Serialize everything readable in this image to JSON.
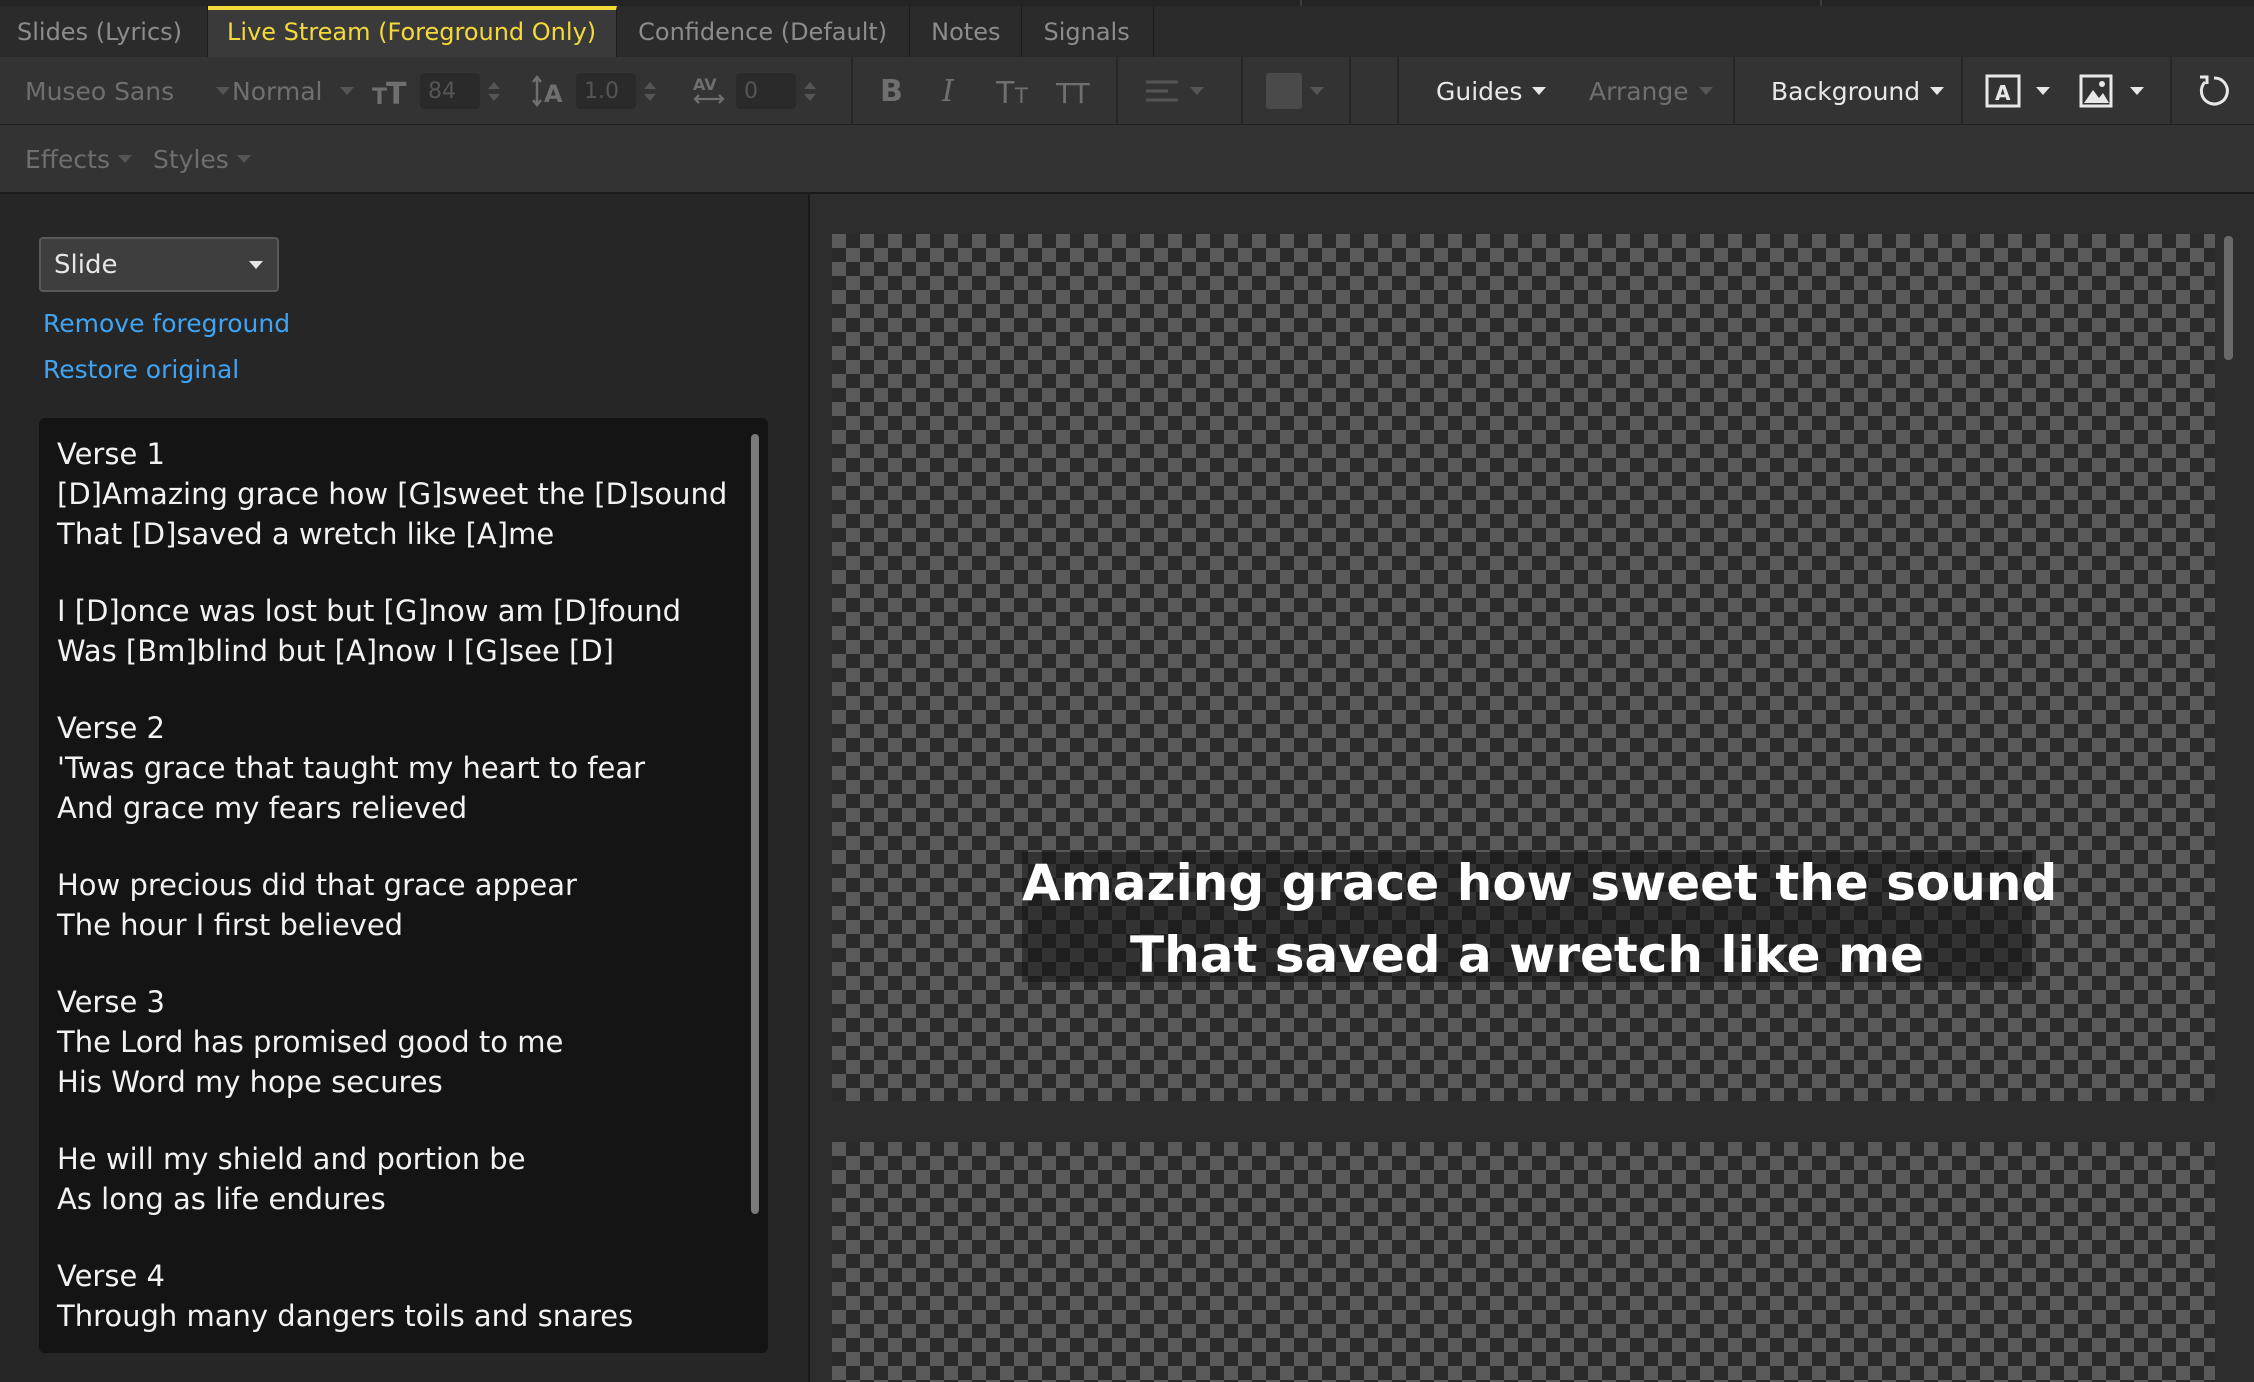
{
  "tabs": [
    {
      "label": "Slides (Lyrics)",
      "active": false
    },
    {
      "label": "Live Stream (Foreground Only)",
      "active": true
    },
    {
      "label": "Confidence (Default)",
      "active": false
    },
    {
      "label": "Notes",
      "active": false
    },
    {
      "label": "Signals",
      "active": false
    }
  ],
  "toolbar": {
    "font_family": "Museo Sans",
    "font_style": "Normal",
    "font_size": "84",
    "line_spacing": "1.0",
    "char_spacing": "0",
    "bold_icon_label": "B",
    "italic_icon_label": "I",
    "guides_label": "Guides",
    "arrange_label": "Arrange",
    "background_label": "Background",
    "effects_label": "Effects",
    "styles_label": "Styles"
  },
  "left_panel": {
    "mode_select_value": "Slide",
    "remove_foreground_link": "Remove foreground",
    "restore_original_link": "Restore original",
    "lyrics_blocks": [
      [
        "Verse 1",
        "[D]Amazing grace how [G]sweet the [D]sound",
        "That [D]saved a wretch like [A]me"
      ],
      [
        "I [D]once was lost but [G]now am [D]found",
        "Was [Bm]blind but [A]now I [G]see [D]"
      ],
      [
        "Verse 2",
        "'Twas grace that taught my heart to fear",
        "And grace my fears relieved"
      ],
      [
        "How precious did that grace appear",
        "The hour I first believed"
      ],
      [
        "Verse 3",
        "The Lord has promised good to me",
        "His Word my hope secures"
      ],
      [
        "He will my shield and portion be",
        "As long as life endures"
      ],
      [
        "Verse 4",
        "Through many dangers toils and snares"
      ]
    ]
  },
  "preview": {
    "slide_line_1": "Amazing grace how sweet the sound",
    "slide_line_2": "That saved a wretch like me"
  },
  "colors": {
    "active_tab_accent": "#f3d93a",
    "link_blue": "#3fa4f4"
  }
}
